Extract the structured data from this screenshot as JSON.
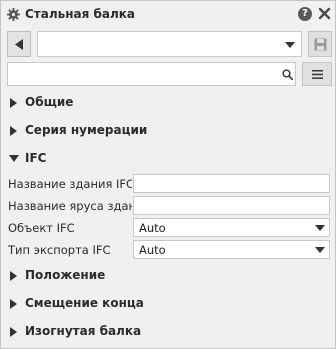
{
  "window": {
    "title": "Стальная балка",
    "help_label": "?",
    "icons": {
      "title": "gear-icon",
      "help": "help-icon",
      "close": "close-icon"
    }
  },
  "toolbar": {
    "preset_value": "",
    "icons": {
      "back": "back-arrow-icon",
      "dropdown": "chevron-down-icon",
      "save": "save-icon"
    }
  },
  "search": {
    "value": "",
    "placeholder": "",
    "icons": {
      "search": "search-icon",
      "menu": "menu-icon"
    }
  },
  "sections": {
    "general": {
      "label": "Общие",
      "expanded": false
    },
    "numbering": {
      "label": "Серия нумерации",
      "expanded": false
    },
    "ifc": {
      "label": "IFC",
      "expanded": true
    },
    "position": {
      "label": "Положение",
      "expanded": false
    },
    "end_offset": {
      "label": "Смещение конца",
      "expanded": false
    },
    "curved_beam": {
      "label": "Изогнутая балка",
      "expanded": false
    }
  },
  "ifc_properties": {
    "building_name": {
      "label": "Название здания IFC",
      "value": ""
    },
    "storey_name": {
      "label": "Название яруса здания",
      "value": ""
    },
    "ifc_object": {
      "label": "Объект IFC",
      "value": "Auto"
    },
    "export_type": {
      "label": "Тип экспорта IFC",
      "value": "Auto"
    }
  },
  "colors": {
    "panel_bg": "#f0f0f0",
    "input_bg": "#ffffff",
    "border": "#c8c8c8",
    "text": "#2b2b2b",
    "icon_dark": "#4a4a4a"
  }
}
